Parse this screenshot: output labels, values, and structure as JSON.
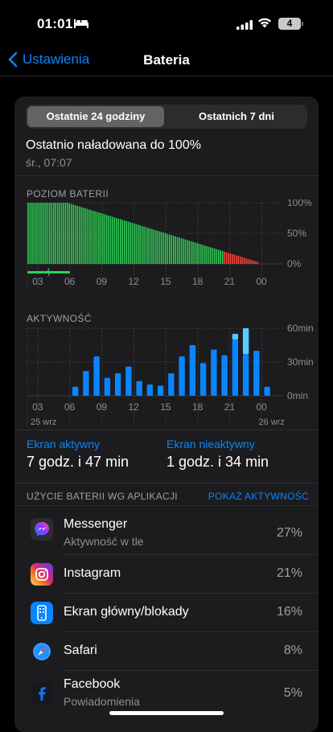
{
  "status_bar": {
    "time": "01:01",
    "battery_level": "4"
  },
  "nav": {
    "back_label": "Ustawienia",
    "title": "Bateria"
  },
  "segment": {
    "active": "Ostatnie 24 godziny",
    "inactive": "Ostatnich 7 dni"
  },
  "last_charge": {
    "title": "Ostatnio naładowana do 100%",
    "subtitle": "śr., 07:07"
  },
  "battery_chart": {
    "label": "POZIOM BATERII",
    "y_ticks": [
      "100%",
      "50%",
      "0%"
    ],
    "x_ticks": [
      "03",
      "06",
      "09",
      "12",
      "15",
      "18",
      "21",
      "00"
    ]
  },
  "activity_chart": {
    "label": "AKTYWNOŚĆ",
    "y_ticks": [
      "60min",
      "30min",
      "0min"
    ],
    "x_ticks": [
      "03",
      "06",
      "09",
      "12",
      "15",
      "18",
      "21",
      "00"
    ],
    "date_left": "25 wrz",
    "date_right": "26 wrz"
  },
  "chart_data": [
    {
      "type": "bar",
      "title": "POZIOM BATERII",
      "ylabel": "",
      "ylim": [
        0,
        100
      ],
      "x_tick_labels": [
        "03",
        "06",
        "09",
        "12",
        "15",
        "18",
        "21",
        "00"
      ],
      "series": [
        {
          "name": "",
          "values": [
            100,
            100,
            100,
            100,
            100,
            100,
            100,
            100,
            100,
            100,
            100,
            100,
            100,
            100,
            100,
            100,
            100,
            100,
            100,
            100,
            100,
            99,
            98,
            97,
            96,
            95,
            94,
            93,
            92,
            91,
            90,
            89,
            88,
            87,
            86,
            85,
            84,
            83,
            82,
            81,
            80,
            79,
            78,
            77,
            76,
            75,
            74,
            73,
            72,
            71,
            70,
            69,
            68,
            67,
            66,
            65,
            64,
            63,
            62,
            61,
            60,
            59,
            58,
            57,
            56,
            55,
            54,
            53,
            52,
            51,
            50,
            49,
            48,
            47,
            46,
            45,
            44,
            43,
            42,
            41,
            40,
            39,
            38,
            37,
            36,
            35,
            34,
            33,
            32,
            31,
            30,
            29,
            28,
            27,
            26,
            25,
            24,
            23,
            22,
            21,
            20,
            19,
            18,
            17,
            16,
            15,
            14,
            13,
            12,
            11,
            10,
            9,
            8,
            7,
            6,
            5,
            4,
            3
          ]
        }
      ],
      "low_threshold": 20,
      "charging_span": [
        "02",
        "06"
      ],
      "colors": {
        "normal": "#30d158",
        "low": "#ff453a",
        "charging": "#30d158"
      }
    },
    {
      "type": "bar",
      "title": "AKTYWNOŚĆ",
      "ylim": [
        0,
        60
      ],
      "categories": [
        "02",
        "03",
        "04",
        "05",
        "06",
        "07",
        "08",
        "09",
        "10",
        "11",
        "12",
        "13",
        "14",
        "15",
        "16",
        "17",
        "18",
        "19",
        "20",
        "21",
        "22",
        "23",
        "00",
        "01"
      ],
      "x_tick_labels": [
        "03",
        "06",
        "09",
        "12",
        "15",
        "18",
        "21",
        "00"
      ],
      "series": [
        {
          "name": "Ekran aktywny",
          "values": [
            0,
            0,
            0,
            0,
            8,
            22,
            35,
            16,
            20,
            26,
            13,
            10,
            9,
            20,
            35,
            45,
            29,
            41,
            36,
            50,
            37,
            40,
            8,
            0
          ]
        },
        {
          "name": "Ekran nieaktywny",
          "values": [
            0,
            0,
            0,
            0,
            0,
            0,
            0,
            0,
            0,
            0,
            0,
            0,
            0,
            0,
            0,
            0,
            0,
            0,
            0,
            5,
            23,
            0,
            0,
            0
          ]
        }
      ],
      "colors": {
        "Ekran aktywny": "#0a84ff",
        "Ekran nieaktywny": "#5ac8fa"
      }
    }
  ],
  "screen_stats": [
    {
      "label": "Ekran aktywny",
      "value": "7 godz. i 47 min"
    },
    {
      "label": "Ekran nieaktywny",
      "value": "1 godz. i 34 min"
    }
  ],
  "usage": {
    "heading": "UŻYCIE BATERII WG APLIKACJI",
    "link": "POKAŻ AKTYWNOŚĆ"
  },
  "apps": [
    {
      "name": "Messenger",
      "subtitle": "Aktywność w tle",
      "percent": "27%",
      "icon": "messenger-icon"
    },
    {
      "name": "Instagram",
      "subtitle": "",
      "percent": "21%",
      "icon": "instagram-icon"
    },
    {
      "name": "Ekran główny/blokady",
      "subtitle": "",
      "percent": "16%",
      "icon": "home-lock-icon"
    },
    {
      "name": "Safari",
      "subtitle": "",
      "percent": "8%",
      "icon": "safari-icon"
    },
    {
      "name": "Facebook",
      "subtitle": "Powiadomienia",
      "percent": "5%",
      "icon": "facebook-icon"
    }
  ]
}
